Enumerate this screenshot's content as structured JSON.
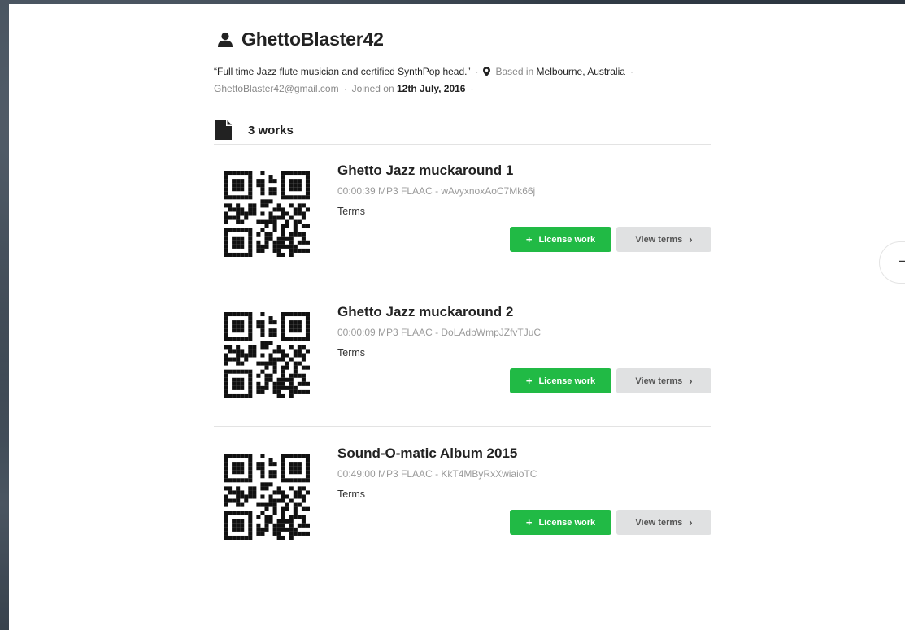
{
  "profile": {
    "username": "GhettoBlaster42",
    "user_icon": "user-icon",
    "bio": "“Full time Jazz flute musician and certified SynthPop head.”",
    "location_prefix": "Based in",
    "location": "Melbourne, Australia",
    "location_icon": "map-marker-icon",
    "email": "GhettoBlaster42@gmail.com",
    "joined_prefix": "Joined on",
    "joined_date": "12th July, 2016",
    "separator": "·"
  },
  "works": {
    "icon": "file-icon",
    "count_label": "3 works",
    "items": [
      {
        "title": "Ghetto Jazz muckaround 1",
        "info": "00:00:39 MP3 FLAAC - wAvyxnoxAoC7Mk66j",
        "terms_label": "Terms",
        "license_label": "License work",
        "view_terms_label": "View terms"
      },
      {
        "title": "Ghetto Jazz muckaround 2",
        "info": "00:00:09 MP3 FLAAC - DoLAdbWmpJZfvTJuC",
        "terms_label": "Terms",
        "license_label": "License work",
        "view_terms_label": "View terms"
      },
      {
        "title": "Sound-O-matic Album 2015",
        "info": "00:49:00 MP3 FLAAC - KkT4MByRxXwiaioTC",
        "terms_label": "Terms",
        "license_label": "License work",
        "view_terms_label": "View terms"
      }
    ]
  },
  "side_button": {
    "label": "–"
  },
  "colors": {
    "license_green": "#21ba45",
    "view_terms_gray": "#e0e1e2",
    "text_dark": "#222222",
    "text_muted": "#888888"
  }
}
